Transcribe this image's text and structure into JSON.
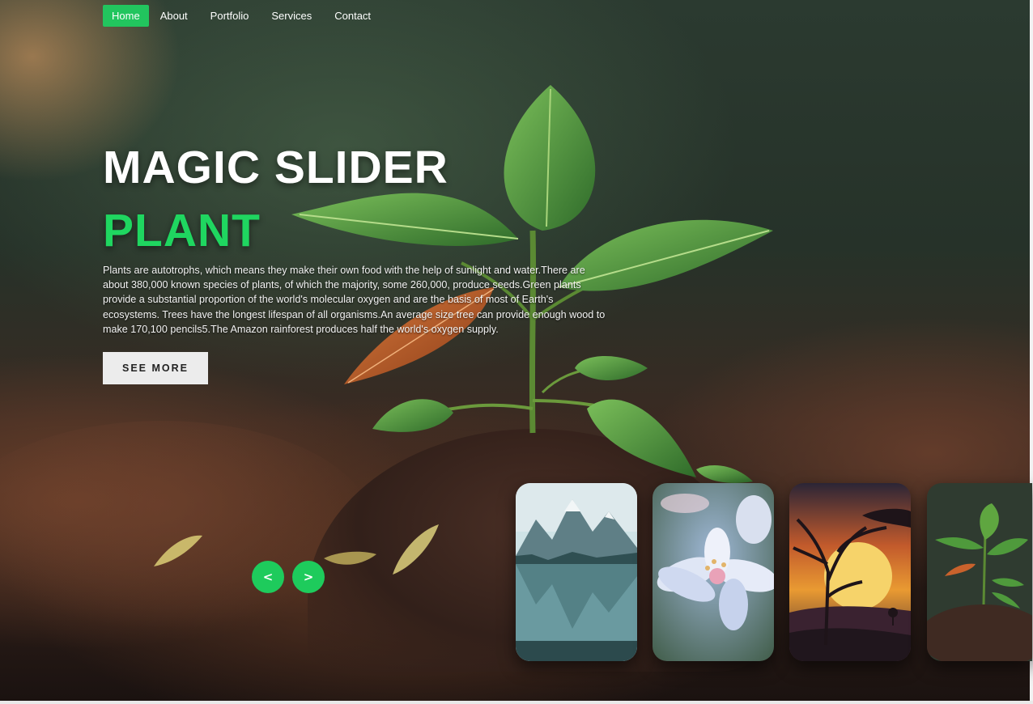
{
  "nav": {
    "items": [
      {
        "label": "Home",
        "active": true
      },
      {
        "label": "About",
        "active": false
      },
      {
        "label": "Portfolio",
        "active": false
      },
      {
        "label": "Services",
        "active": false
      },
      {
        "label": "Contact",
        "active": false
      }
    ]
  },
  "hero": {
    "title": "MAGIC SLIDER",
    "subtitle": "PLANT",
    "description": "Plants are autotrophs, which means they make their own food with the help of sunlight and water.There are about 380,000 known species of plants, of which the majority, some 260,000, produce seeds.Green plants provide a substantial proportion of the world's molecular oxygen and are the basis of most of Earth's ecosystems. Trees have the longest lifespan of all organisms.An average size tree can provide enough wood to make 170,100 pencils5.The Amazon rainforest produces half the world's oxygen supply.",
    "button_label": "SEE MORE"
  },
  "controls": {
    "prev_label": "<",
    "next_label": ">"
  },
  "thumbnails": [
    {
      "subject": "mountain-lake"
    },
    {
      "subject": "flower"
    },
    {
      "subject": "sunset-tree"
    },
    {
      "subject": "plant-sprout"
    }
  ],
  "colors": {
    "accent": "#22c55e",
    "subtitle": "#1fd660",
    "button_bg": "#ececec"
  }
}
